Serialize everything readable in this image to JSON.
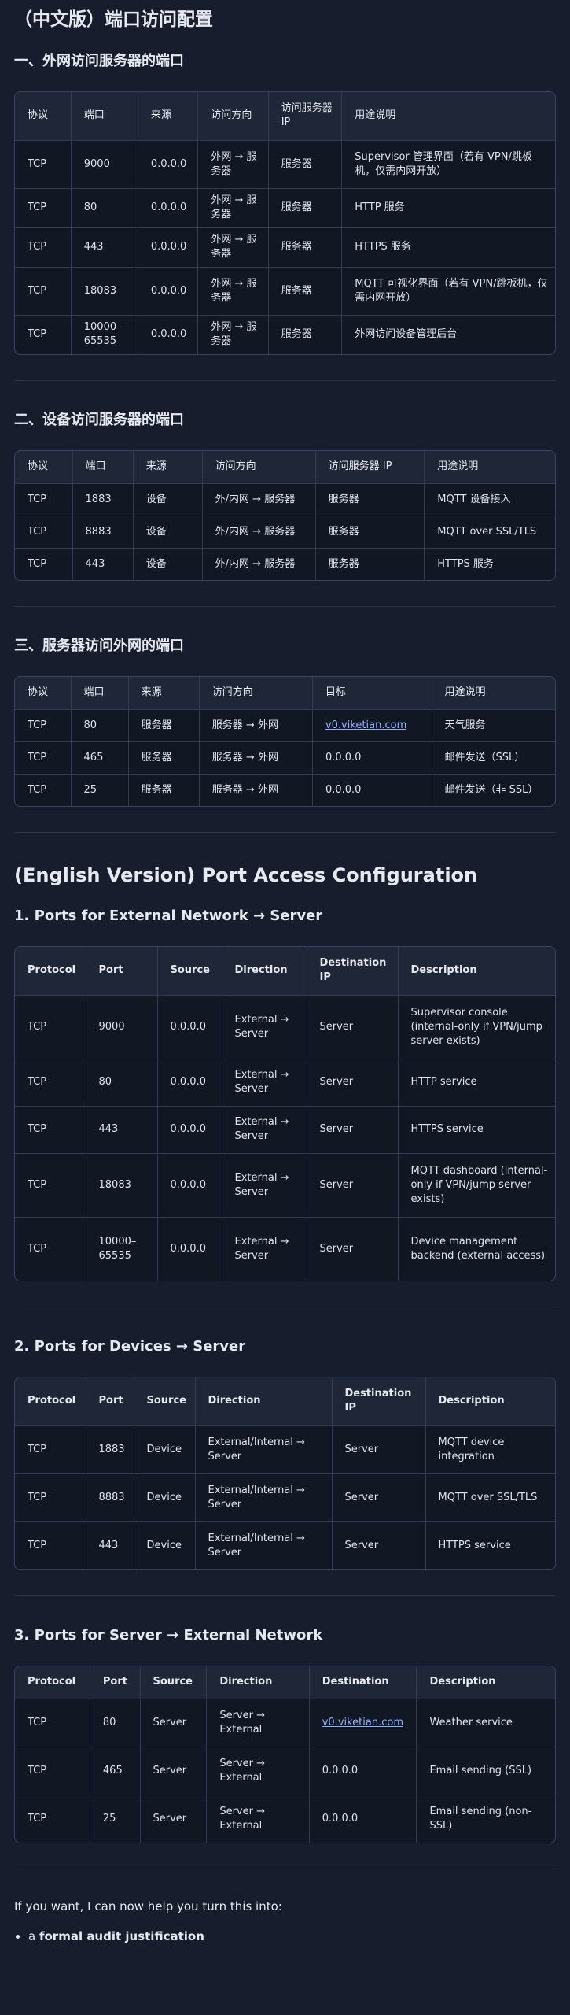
{
  "zh": {
    "title": "（中文版）端口访问配置",
    "sections": [
      {
        "heading": "一、外网访问服务器的端口",
        "columns": [
          "协议",
          "端口",
          "来源",
          "访问方向",
          "访问服务器 IP",
          "用途说明"
        ],
        "rows": [
          [
            "TCP",
            "9000",
            "0.0.0.0",
            "外网 → 服务器",
            "服务器",
            "Supervisor 管理界面（若有 VPN/跳板机，仅需内网开放）"
          ],
          [
            "TCP",
            "80",
            "0.0.0.0",
            "外网 → 服务器",
            "服务器",
            "HTTP 服务"
          ],
          [
            "TCP",
            "443",
            "0.0.0.0",
            "外网 → 服务器",
            "服务器",
            "HTTPS 服务"
          ],
          [
            "TCP",
            "18083",
            "0.0.0.0",
            "外网 → 服务器",
            "服务器",
            "MQTT 可视化界面（若有 VPN/跳板机，仅需内网开放）"
          ],
          [
            "TCP",
            "10000–65535",
            "0.0.0.0",
            "外网 → 服务器",
            "服务器",
            "外网访问设备管理后台"
          ]
        ]
      },
      {
        "heading": "二、设备访问服务器的端口",
        "columns": [
          "协议",
          "端口",
          "来源",
          "访问方向",
          "访问服务器 IP",
          "用途说明"
        ],
        "rows": [
          [
            "TCP",
            "1883",
            "设备",
            "外/内网 → 服务器",
            "服务器",
            "MQTT 设备接入"
          ],
          [
            "TCP",
            "8883",
            "设备",
            "外/内网 → 服务器",
            "服务器",
            "MQTT over SSL/TLS"
          ],
          [
            "TCP",
            "443",
            "设备",
            "外/内网 → 服务器",
            "服务器",
            "HTTPS 服务"
          ]
        ]
      },
      {
        "heading": "三、服务器访问外网的端口",
        "columns": [
          "协议",
          "端口",
          "来源",
          "访问方向",
          "目标",
          "用途说明"
        ],
        "rows": [
          [
            "TCP",
            "80",
            "服务器",
            "服务器 → 外网",
            "v0.viketian.com",
            "天气服务"
          ],
          [
            "TCP",
            "465",
            "服务器",
            "服务器 → 外网",
            "0.0.0.0",
            "邮件发送（SSL）"
          ],
          [
            "TCP",
            "25",
            "服务器",
            "服务器 → 外网",
            "0.0.0.0",
            "邮件发送（非 SSL）"
          ]
        ]
      }
    ]
  },
  "en": {
    "title": "(English Version) Port Access Configuration",
    "sections": [
      {
        "heading": "1. Ports for External Network → Server",
        "columns": [
          "Protocol",
          "Port",
          "Source",
          "Direction",
          "Destination IP",
          "Description"
        ],
        "rows": [
          [
            "TCP",
            "9000",
            "0.0.0.0",
            "External → Server",
            "Server",
            "Supervisor console (internal-only if VPN/jump server exists)"
          ],
          [
            "TCP",
            "80",
            "0.0.0.0",
            "External → Server",
            "Server",
            "HTTP service"
          ],
          [
            "TCP",
            "443",
            "0.0.0.0",
            "External → Server",
            "Server",
            "HTTPS service"
          ],
          [
            "TCP",
            "18083",
            "0.0.0.0",
            "External → Server",
            "Server",
            "MQTT dashboard (internal-only if VPN/jump server exists)"
          ],
          [
            "TCP",
            "10000–65535",
            "0.0.0.0",
            "External → Server",
            "Server",
            "Device management backend (external access)"
          ]
        ]
      },
      {
        "heading": "2. Ports for Devices → Server",
        "columns": [
          "Protocol",
          "Port",
          "Source",
          "Direction",
          "Destination IP",
          "Description"
        ],
        "rows": [
          [
            "TCP",
            "1883",
            "Device",
            "External/Internal → Server",
            "Server",
            "MQTT device integration"
          ],
          [
            "TCP",
            "8883",
            "Device",
            "External/Internal → Server",
            "Server",
            "MQTT over SSL/TLS"
          ],
          [
            "TCP",
            "443",
            "Device",
            "External/Internal → Server",
            "Server",
            "HTTPS service"
          ]
        ]
      },
      {
        "heading": "3. Ports for Server → External Network",
        "columns": [
          "Protocol",
          "Port",
          "Source",
          "Direction",
          "Destination",
          "Description"
        ],
        "rows": [
          [
            "TCP",
            "80",
            "Server",
            "Server → External",
            "v0.viketian.com",
            "Weather service"
          ],
          [
            "TCP",
            "465",
            "Server",
            "Server → External",
            "0.0.0.0",
            "Email sending (SSL)"
          ],
          [
            "TCP",
            "25",
            "Server",
            "Server → External",
            "0.0.0.0",
            "Email sending (non-SSL)"
          ]
        ]
      }
    ]
  },
  "closing": {
    "text": "If you want, I can now help you turn this into:",
    "bullet_prefix": "a ",
    "bullet_bold": "formal audit justification"
  }
}
